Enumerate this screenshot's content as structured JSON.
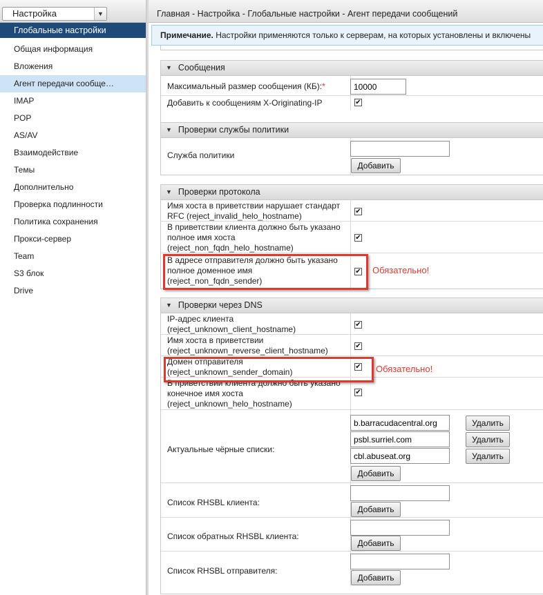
{
  "sidebar": {
    "selector_label": "Настройка",
    "section_title": "Глобальные настройки",
    "items": [
      {
        "label": "Общая информация"
      },
      {
        "label": "Вложения"
      },
      {
        "label": "Агент передачи сообще…"
      },
      {
        "label": "IMAP"
      },
      {
        "label": "POP"
      },
      {
        "label": "AS/AV"
      },
      {
        "label": "Взаимодействие"
      },
      {
        "label": "Темы"
      },
      {
        "label": "Дополнительно"
      },
      {
        "label": "Проверка подлинности"
      },
      {
        "label": "Политика сохранения"
      },
      {
        "label": "Прокси-сервер"
      },
      {
        "label": "Team"
      },
      {
        "label": "S3 блок"
      },
      {
        "label": "Drive"
      }
    ],
    "active_item": "Агент передачи сообще…"
  },
  "breadcrumb": "Главная - Настройка - Глобальные настройки - Агент передачи сообщений",
  "note": {
    "prefix": "Примечание.",
    "text": " Настройки применяются только к серверам, на которых установлены и включены"
  },
  "sections": {
    "messages": {
      "title": "Сообщения",
      "max_size_label": "Максимальный размер сообщения (КБ):",
      "required_mark": "*",
      "max_size_value": "10000",
      "x_originating_label": "Добавить к сообщениям X-Originating-IP",
      "x_originating_checked": true
    },
    "policy": {
      "title": "Проверки службы политики",
      "service_label": "Служба политики",
      "add_button": "Добавить"
    },
    "protocol": {
      "title": "Проверки протокола",
      "invalid_helo_label": "Имя хоста в приветствии нарушает стандарт RFC (reject_invalid_helo_hostname)",
      "non_fqdn_helo_label": "В приветствии клиента должно быть указано полное имя хоста (reject_non_fqdn_helo_hostname)",
      "non_fqdn_sender_label": "В адресе отправителя должно быть указано полное доменное имя (reject_non_fqdn_sender)",
      "mandatory": "Обязательно!"
    },
    "dns": {
      "title": "Проверки через DNS",
      "client_hostname_label": "IP-адрес клиента (reject_unknown_client_hostname)",
      "reverse_client_label": "Имя хоста в приветствии (reject_unknown_reverse_client_hostname)",
      "sender_domain_label": "Домен отправителя (reject_unknown_sender_domain)",
      "helo_hostname_label": "В приветствии клиента должно быть указано конечное имя хоста (reject_unknown_helo_hostname)",
      "mandatory": "Обязательно!",
      "blacklists_label": "Актуальные чёрные списки:",
      "blacklists": [
        {
          "value": "b.barracudacentral.org",
          "button": "Удалить"
        },
        {
          "value": "psbl.surriel.com",
          "button": "Удалить"
        },
        {
          "value": "cbl.abuseat.org",
          "button": "Удалить"
        }
      ],
      "add_button": "Добавить",
      "rhsbl_client_label": "Список RHSBL клиента:",
      "rhsbl_reverse_label": "Список обратных RHSBL клиента:",
      "rhsbl_sender_label": "Список RHSBL отправителя:"
    }
  },
  "checkmark": "✔",
  "colors": {
    "sidebar_header": "#1e4a7a",
    "active_item": "#cfe3f7",
    "note_bg": "#e8f3fc",
    "highlight": "#e0382f"
  }
}
